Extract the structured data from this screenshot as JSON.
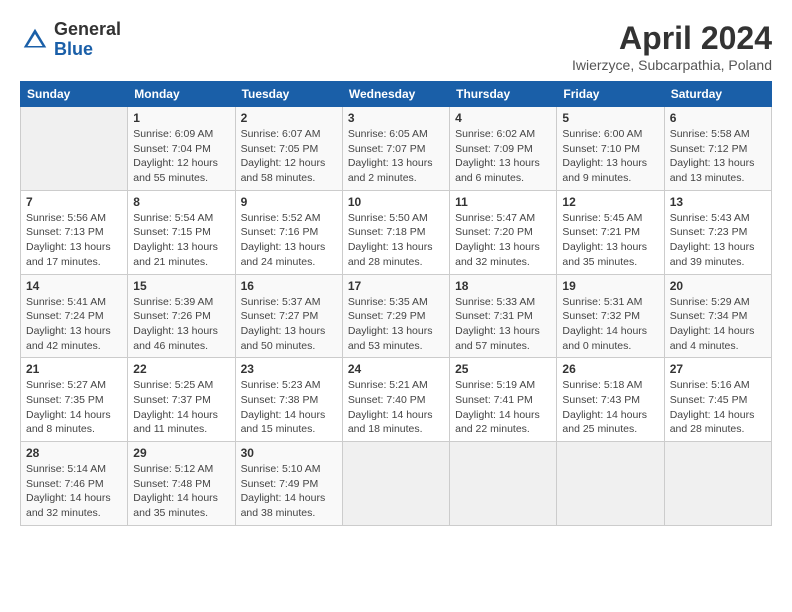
{
  "header": {
    "logo_general": "General",
    "logo_blue": "Blue",
    "month_title": "April 2024",
    "subtitle": "Iwierzyce, Subcarpathia, Poland"
  },
  "days_of_week": [
    "Sunday",
    "Monday",
    "Tuesday",
    "Wednesday",
    "Thursday",
    "Friday",
    "Saturday"
  ],
  "weeks": [
    [
      {
        "num": "",
        "info": ""
      },
      {
        "num": "1",
        "info": "Sunrise: 6:09 AM\nSunset: 7:04 PM\nDaylight: 12 hours\nand 55 minutes."
      },
      {
        "num": "2",
        "info": "Sunrise: 6:07 AM\nSunset: 7:05 PM\nDaylight: 12 hours\nand 58 minutes."
      },
      {
        "num": "3",
        "info": "Sunrise: 6:05 AM\nSunset: 7:07 PM\nDaylight: 13 hours\nand 2 minutes."
      },
      {
        "num": "4",
        "info": "Sunrise: 6:02 AM\nSunset: 7:09 PM\nDaylight: 13 hours\nand 6 minutes."
      },
      {
        "num": "5",
        "info": "Sunrise: 6:00 AM\nSunset: 7:10 PM\nDaylight: 13 hours\nand 9 minutes."
      },
      {
        "num": "6",
        "info": "Sunrise: 5:58 AM\nSunset: 7:12 PM\nDaylight: 13 hours\nand 13 minutes."
      }
    ],
    [
      {
        "num": "7",
        "info": "Sunrise: 5:56 AM\nSunset: 7:13 PM\nDaylight: 13 hours\nand 17 minutes."
      },
      {
        "num": "8",
        "info": "Sunrise: 5:54 AM\nSunset: 7:15 PM\nDaylight: 13 hours\nand 21 minutes."
      },
      {
        "num": "9",
        "info": "Sunrise: 5:52 AM\nSunset: 7:16 PM\nDaylight: 13 hours\nand 24 minutes."
      },
      {
        "num": "10",
        "info": "Sunrise: 5:50 AM\nSunset: 7:18 PM\nDaylight: 13 hours\nand 28 minutes."
      },
      {
        "num": "11",
        "info": "Sunrise: 5:47 AM\nSunset: 7:20 PM\nDaylight: 13 hours\nand 32 minutes."
      },
      {
        "num": "12",
        "info": "Sunrise: 5:45 AM\nSunset: 7:21 PM\nDaylight: 13 hours\nand 35 minutes."
      },
      {
        "num": "13",
        "info": "Sunrise: 5:43 AM\nSunset: 7:23 PM\nDaylight: 13 hours\nand 39 minutes."
      }
    ],
    [
      {
        "num": "14",
        "info": "Sunrise: 5:41 AM\nSunset: 7:24 PM\nDaylight: 13 hours\nand 42 minutes."
      },
      {
        "num": "15",
        "info": "Sunrise: 5:39 AM\nSunset: 7:26 PM\nDaylight: 13 hours\nand 46 minutes."
      },
      {
        "num": "16",
        "info": "Sunrise: 5:37 AM\nSunset: 7:27 PM\nDaylight: 13 hours\nand 50 minutes."
      },
      {
        "num": "17",
        "info": "Sunrise: 5:35 AM\nSunset: 7:29 PM\nDaylight: 13 hours\nand 53 minutes."
      },
      {
        "num": "18",
        "info": "Sunrise: 5:33 AM\nSunset: 7:31 PM\nDaylight: 13 hours\nand 57 minutes."
      },
      {
        "num": "19",
        "info": "Sunrise: 5:31 AM\nSunset: 7:32 PM\nDaylight: 14 hours\nand 0 minutes."
      },
      {
        "num": "20",
        "info": "Sunrise: 5:29 AM\nSunset: 7:34 PM\nDaylight: 14 hours\nand 4 minutes."
      }
    ],
    [
      {
        "num": "21",
        "info": "Sunrise: 5:27 AM\nSunset: 7:35 PM\nDaylight: 14 hours\nand 8 minutes."
      },
      {
        "num": "22",
        "info": "Sunrise: 5:25 AM\nSunset: 7:37 PM\nDaylight: 14 hours\nand 11 minutes."
      },
      {
        "num": "23",
        "info": "Sunrise: 5:23 AM\nSunset: 7:38 PM\nDaylight: 14 hours\nand 15 minutes."
      },
      {
        "num": "24",
        "info": "Sunrise: 5:21 AM\nSunset: 7:40 PM\nDaylight: 14 hours\nand 18 minutes."
      },
      {
        "num": "25",
        "info": "Sunrise: 5:19 AM\nSunset: 7:41 PM\nDaylight: 14 hours\nand 22 minutes."
      },
      {
        "num": "26",
        "info": "Sunrise: 5:18 AM\nSunset: 7:43 PM\nDaylight: 14 hours\nand 25 minutes."
      },
      {
        "num": "27",
        "info": "Sunrise: 5:16 AM\nSunset: 7:45 PM\nDaylight: 14 hours\nand 28 minutes."
      }
    ],
    [
      {
        "num": "28",
        "info": "Sunrise: 5:14 AM\nSunset: 7:46 PM\nDaylight: 14 hours\nand 32 minutes."
      },
      {
        "num": "29",
        "info": "Sunrise: 5:12 AM\nSunset: 7:48 PM\nDaylight: 14 hours\nand 35 minutes."
      },
      {
        "num": "30",
        "info": "Sunrise: 5:10 AM\nSunset: 7:49 PM\nDaylight: 14 hours\nand 38 minutes."
      },
      {
        "num": "",
        "info": ""
      },
      {
        "num": "",
        "info": ""
      },
      {
        "num": "",
        "info": ""
      },
      {
        "num": "",
        "info": ""
      }
    ]
  ]
}
